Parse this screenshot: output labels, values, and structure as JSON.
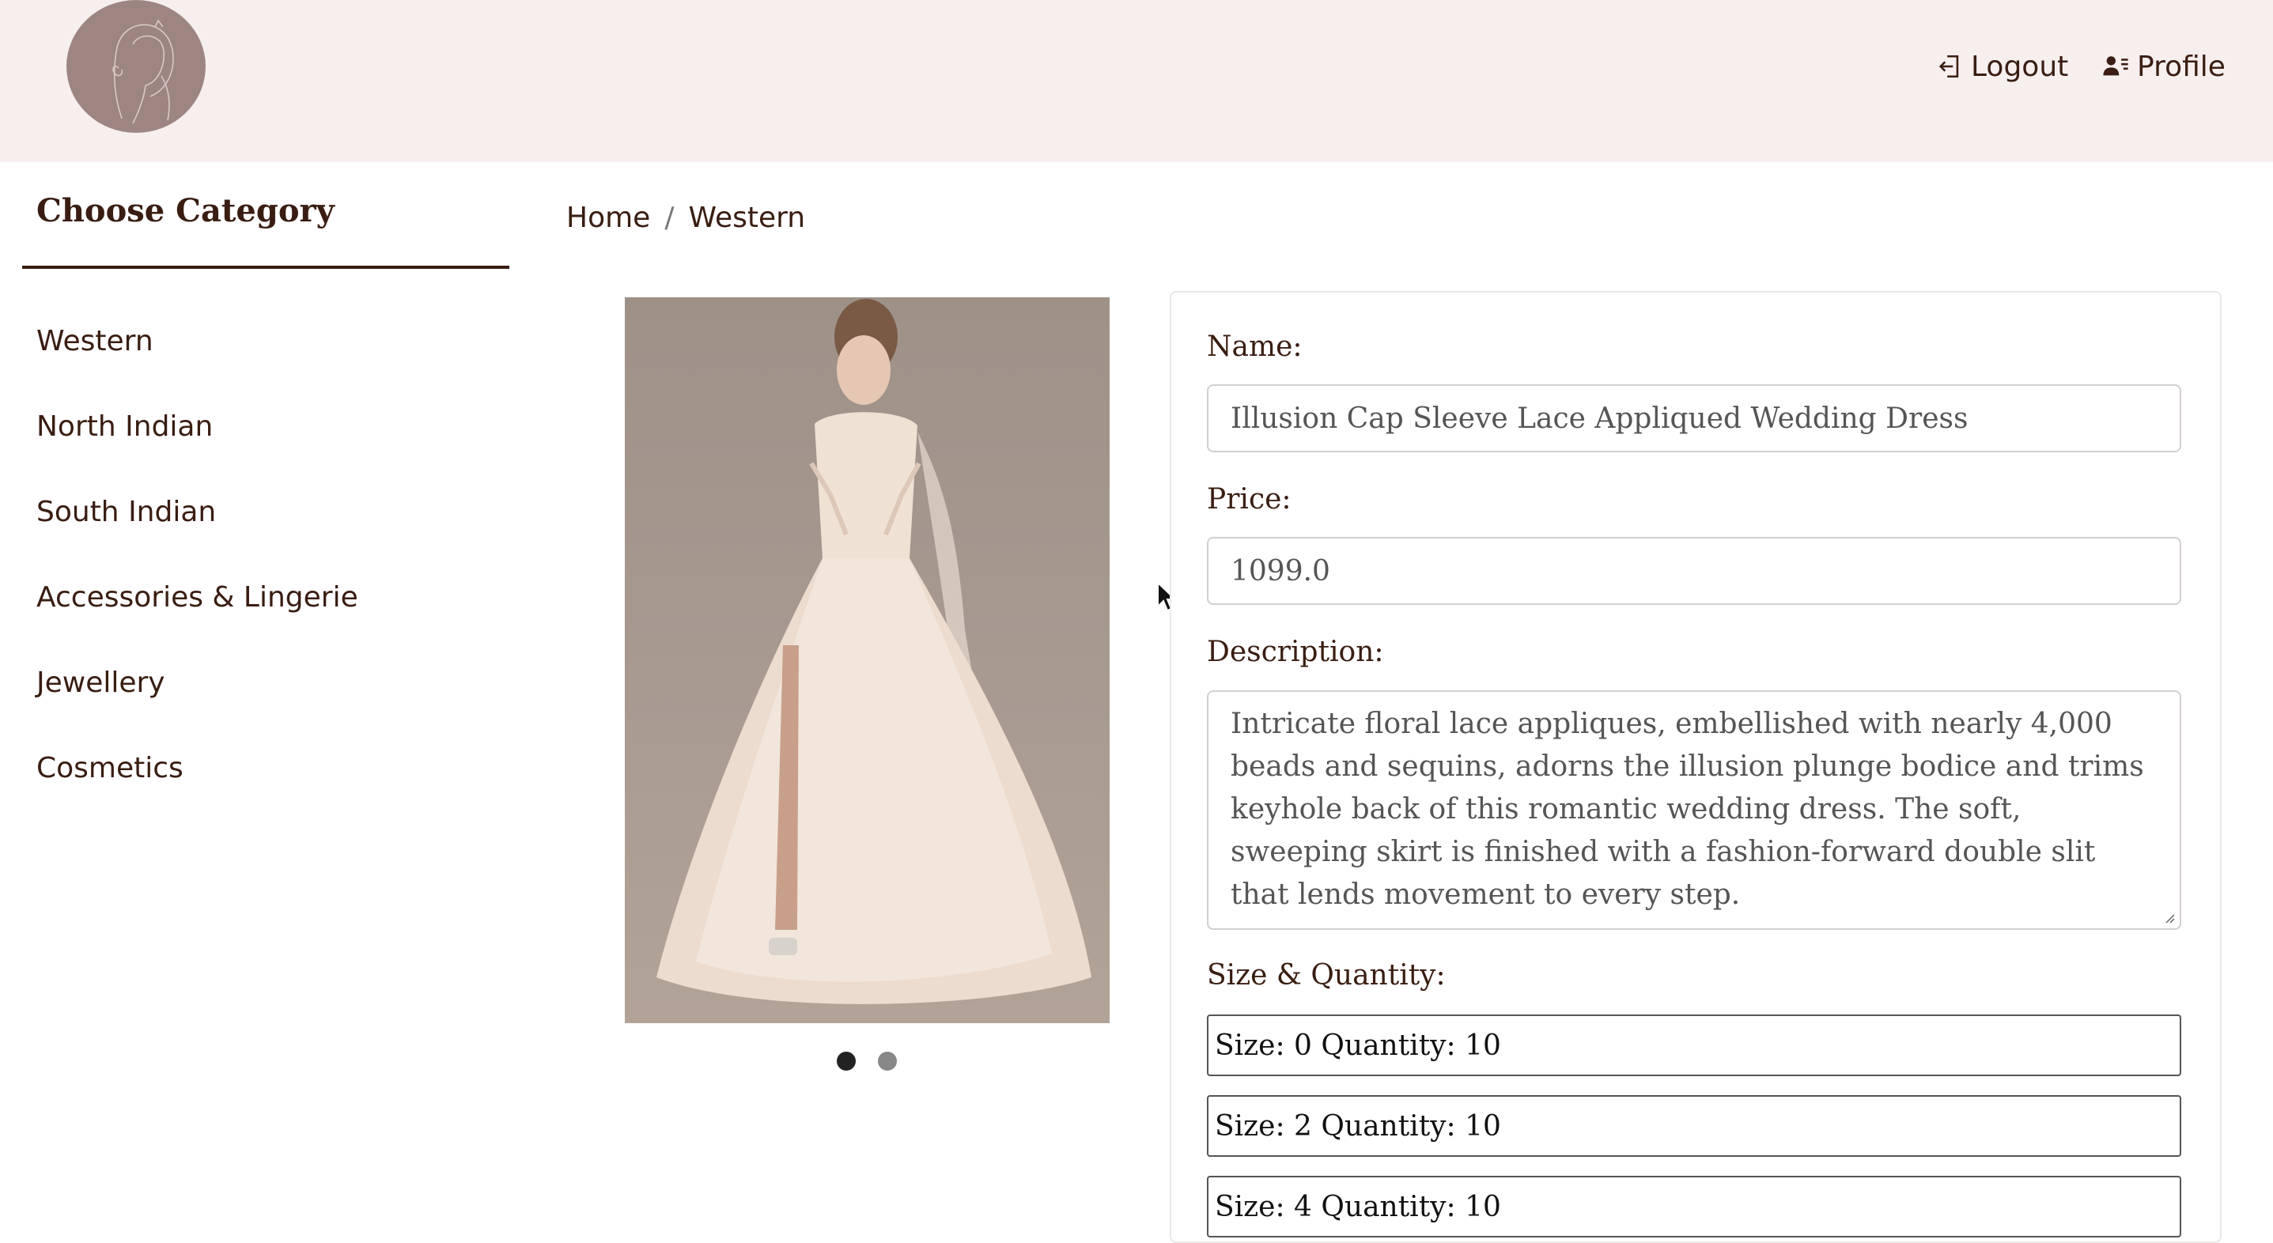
{
  "header": {
    "logout_label": "Logout",
    "profile_label": "Profile"
  },
  "sidebar": {
    "title": "Choose Category",
    "items": [
      {
        "label": "Western"
      },
      {
        "label": "North Indian"
      },
      {
        "label": "South Indian"
      },
      {
        "label": "Accessories & Lingerie"
      },
      {
        "label": "Jewellery"
      },
      {
        "label": "Cosmetics"
      }
    ]
  },
  "breadcrumb": {
    "home": "Home",
    "separator": "/",
    "current": "Western"
  },
  "carousel": {
    "slide_count": 2,
    "active_slide": 1
  },
  "product": {
    "name_label": "Name:",
    "name_value": "Illusion Cap Sleeve Lace Appliqued Wedding Dress",
    "price_label": "Price:",
    "price_value": "1099.0",
    "description_label": "Description:",
    "description_value": "Intricate floral lace appliques, embellished with nearly 4,000 beads and sequins, adorns the illusion plunge bodice and trims keyhole back of this romantic wedding dress. The soft, sweeping skirt is finished with a fashion-forward double slit that lends movement to every step.",
    "sizes_label": "Size & Quantity:",
    "sizes": [
      {
        "text": "Size: 0 Quantity: 10"
      },
      {
        "text": "Size: 2 Quantity: 10"
      },
      {
        "text": "Size: 4 Quantity: 10"
      }
    ]
  },
  "icons": {
    "logout": "logout-icon",
    "profile": "profile-list-icon",
    "logo": "woman-silhouette-logo",
    "cursor": "mouse-pointer-icon"
  },
  "colors": {
    "header_bg": "#f6efee",
    "text_brown": "#3a1d12",
    "logo_bg": "#9d8682"
  }
}
